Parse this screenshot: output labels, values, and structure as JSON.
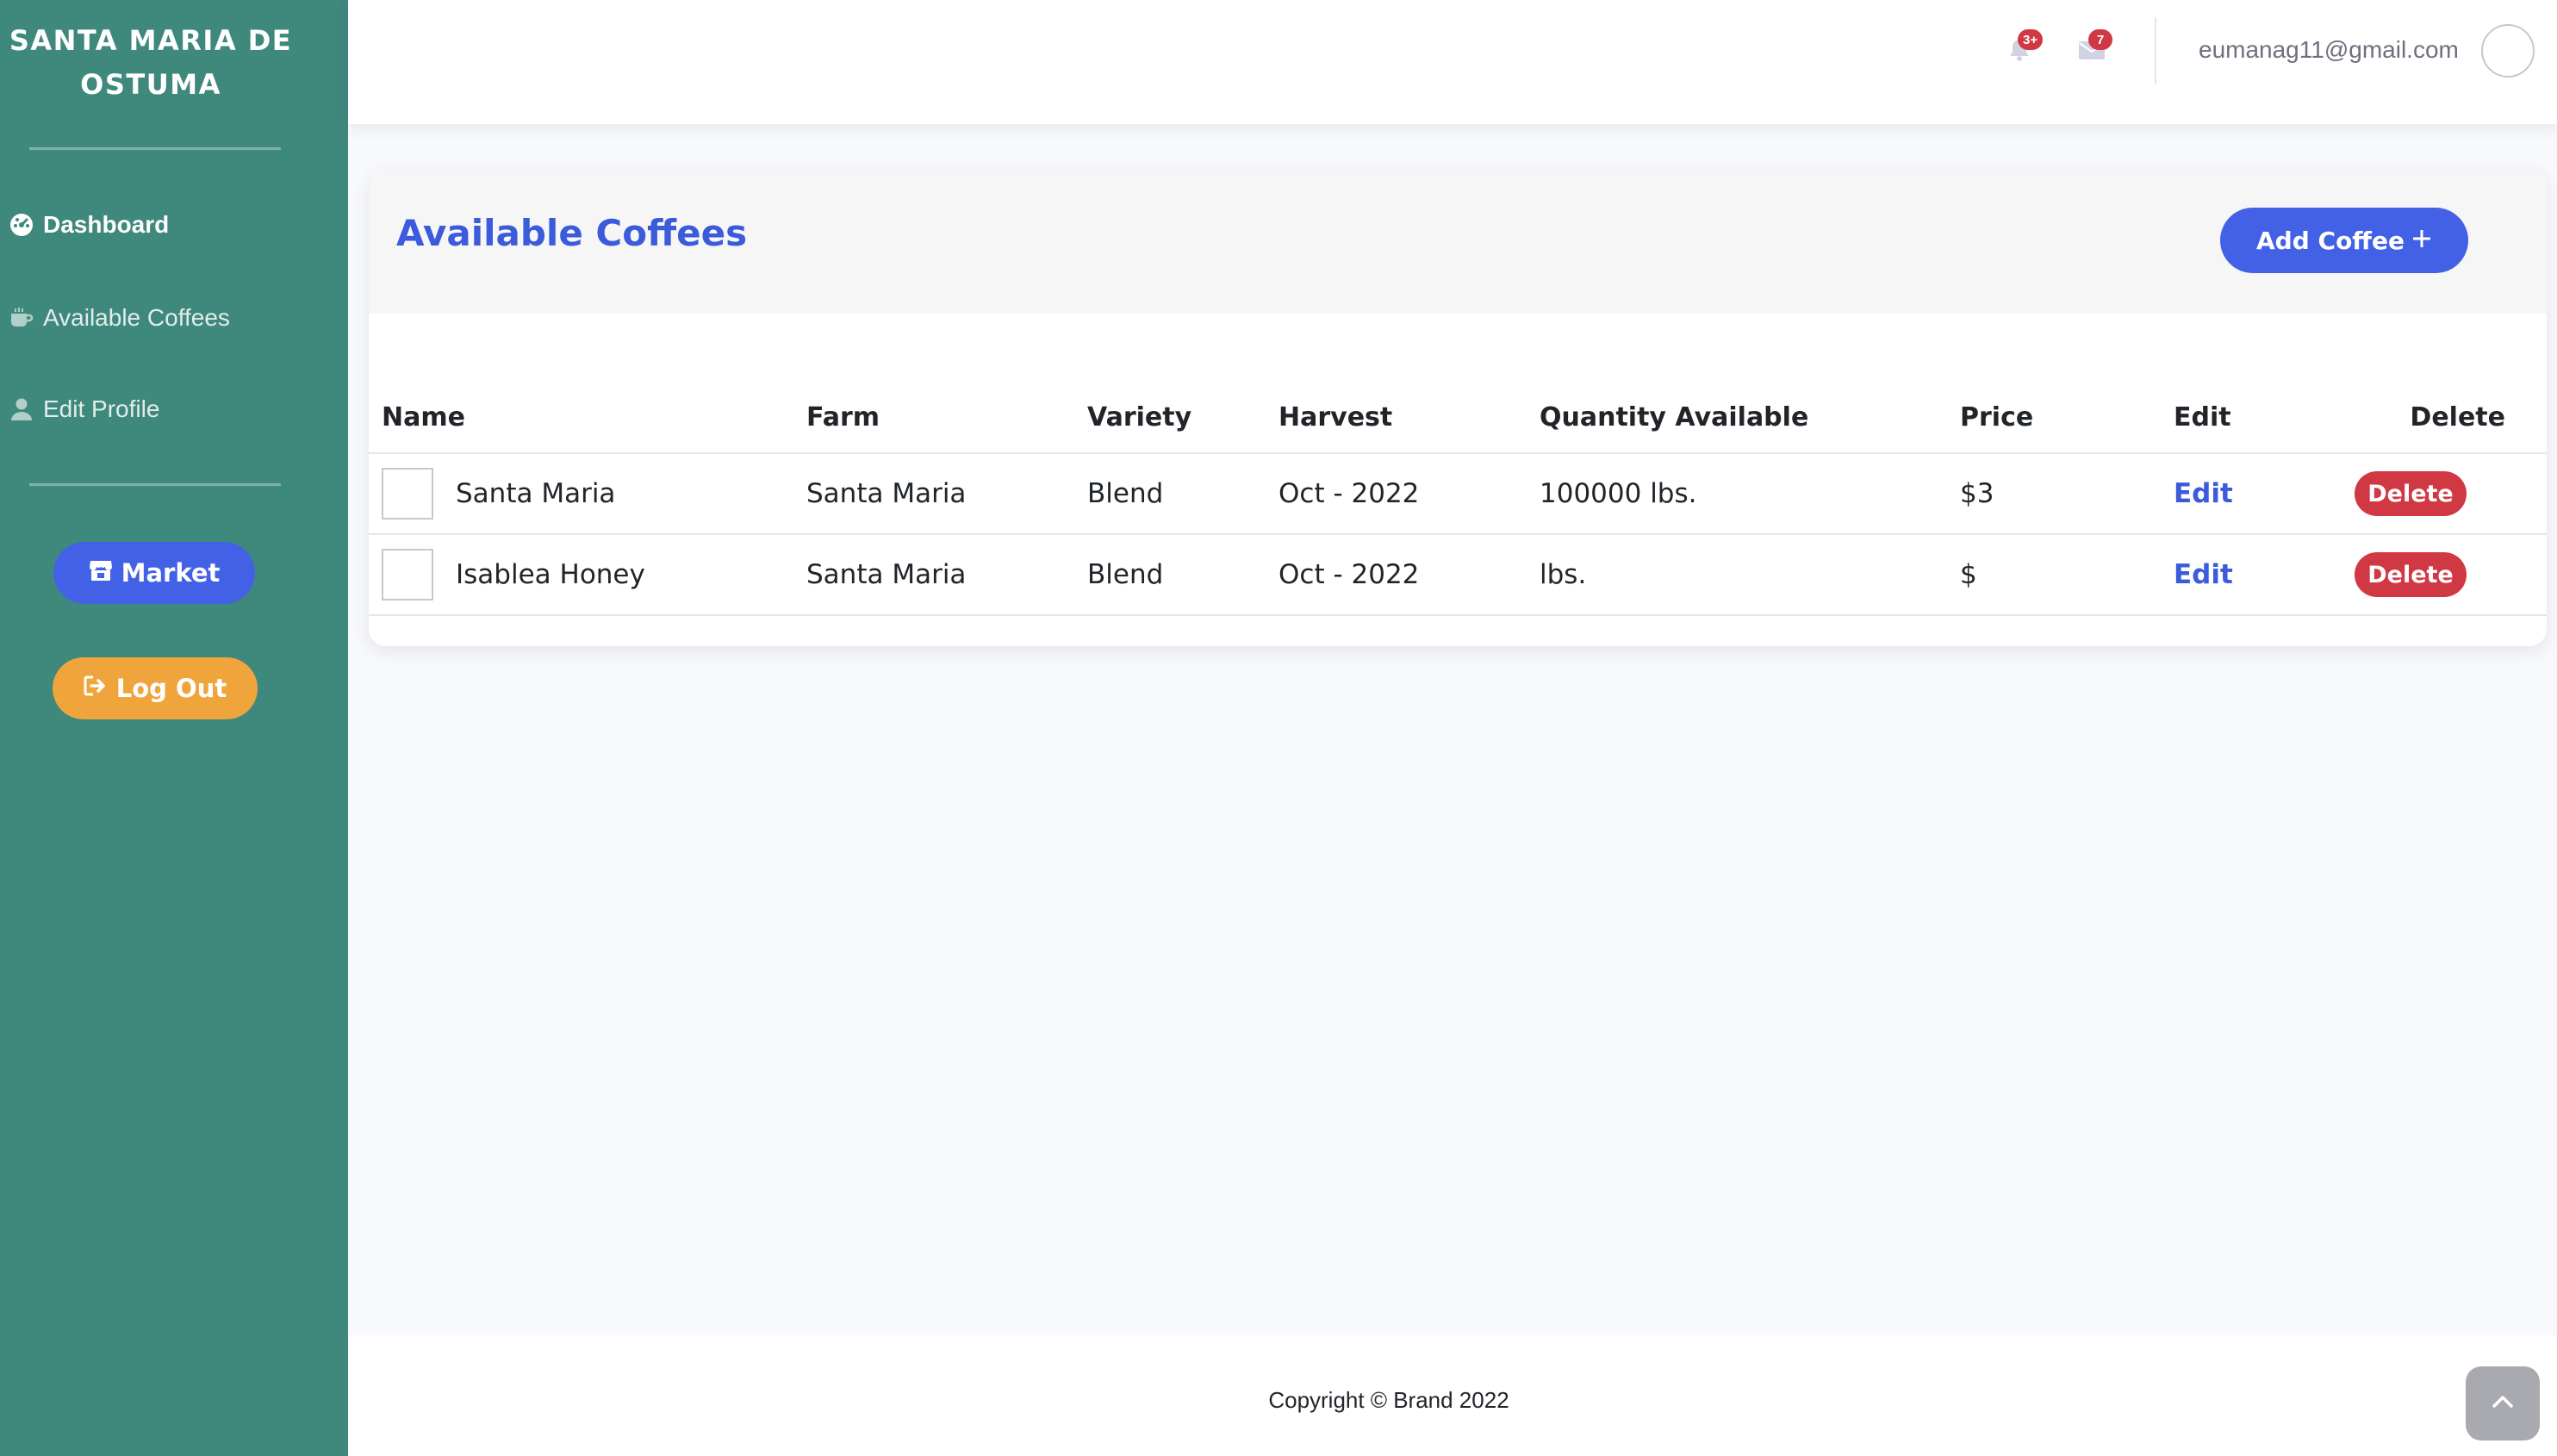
{
  "sidebar": {
    "brand": "SANTA MARIA DE OSTUMA",
    "items": [
      {
        "label": "Dashboard",
        "icon": "dashboard-icon",
        "active": true
      },
      {
        "label": "Available Coffees",
        "icon": "coffee-cup-icon",
        "active": false
      },
      {
        "label": "Edit Profile",
        "icon": "user-icon",
        "active": false
      }
    ],
    "market_label": "Market",
    "logout_label": "Log Out"
  },
  "topbar": {
    "alerts_badge": "3+",
    "messages_badge": "7",
    "user_email": "eumanag11@gmail.com"
  },
  "main": {
    "title": "Available Coffees",
    "add_button_label": "Add Coffee",
    "table": {
      "columns": [
        "Name",
        "Farm",
        "Variety",
        "Harvest",
        "Quantity Available",
        "Price",
        "Edit",
        "Delete"
      ],
      "rows": [
        {
          "name": "Santa Maria",
          "farm": "Santa Maria",
          "variety": "Blend",
          "harvest": "Oct - 2022",
          "quantity": "100000 lbs.",
          "price": "$3",
          "edit": "Edit",
          "delete": "Delete"
        },
        {
          "name": "Isablea Honey",
          "farm": "Santa Maria",
          "variety": "Blend",
          "harvest": "Oct - 2022",
          "quantity": "lbs.",
          "price": "$",
          "edit": "Edit",
          "delete": "Delete"
        }
      ]
    }
  },
  "footer": {
    "copyright": "Copyright © Brand 2022"
  },
  "colors": {
    "sidebar_bg": "#3f887c",
    "primary": "#4361e6",
    "title_blue": "#3b5bdb",
    "warning": "#f0a53c",
    "danger": "#d03844"
  }
}
